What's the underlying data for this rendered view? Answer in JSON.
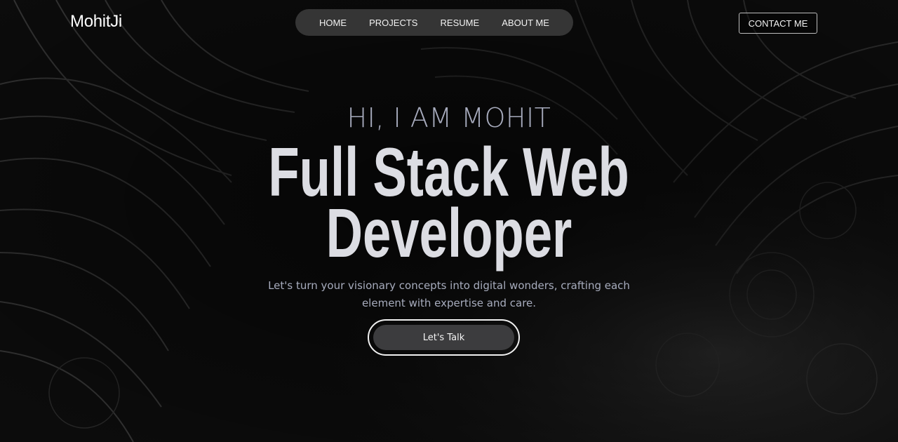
{
  "brand": {
    "logo": "MohitJi"
  },
  "nav": {
    "items": [
      {
        "label": "HOME"
      },
      {
        "label": "PROJECTS"
      },
      {
        "label": "RESUME"
      },
      {
        "label": "ABOUT ME"
      }
    ],
    "contact_label": "CONTACT ME"
  },
  "hero": {
    "greeting": "HI, I AM MOHIT",
    "headline_line1": "Full Stack Web",
    "headline_line2": "Developer",
    "subtext": "Let's turn your visionary concepts into digital wonders, crafting each element with expertise and care.",
    "cta_label": "Let's Talk"
  },
  "colors": {
    "background": "#0b0b0b",
    "headline": "#dcdde3",
    "greeting": "#a7abbd",
    "subtext": "#a7acbd",
    "cta_fill": "#3c3c3e",
    "nav_pill": "#464646"
  }
}
